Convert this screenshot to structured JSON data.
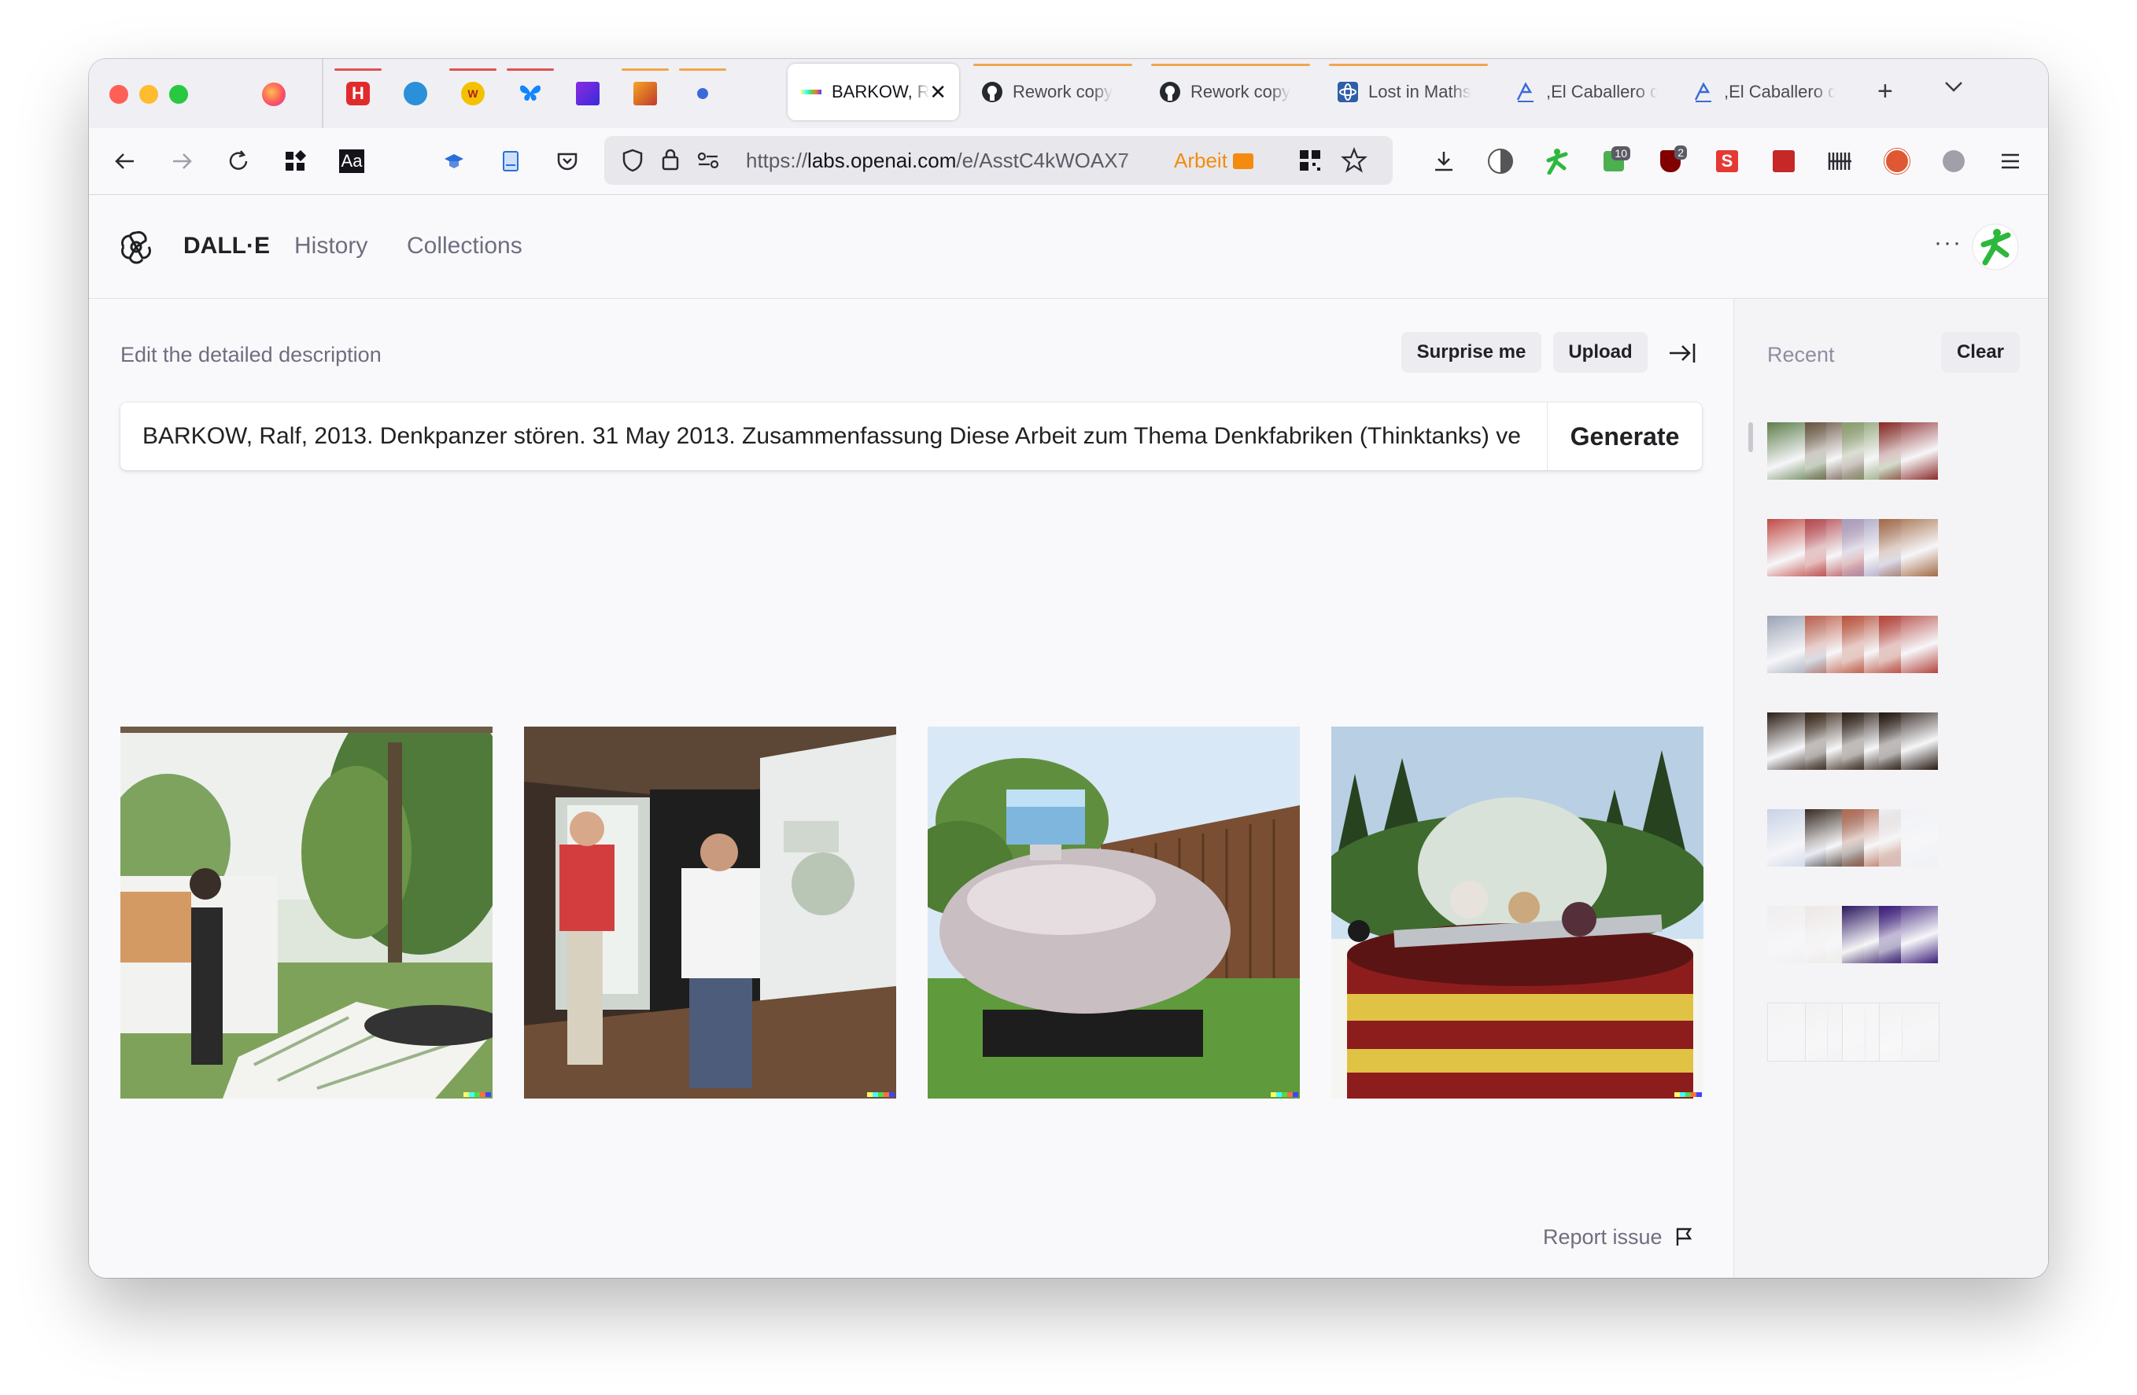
{
  "browser": {
    "pinned_tabs": [
      {
        "icon": "firefox-icon",
        "color": "#ff7139"
      },
      {
        "icon": "h-logo-icon",
        "color": "#e02b2b",
        "letter": "H"
      },
      {
        "icon": "globe-icon",
        "color": "#2a90d9"
      },
      {
        "icon": "wiki-icon",
        "color": "#c6a700"
      },
      {
        "icon": "butterfly-icon",
        "color": "#1185fe"
      },
      {
        "icon": "purple-square-icon",
        "color": "#6a2bd9"
      },
      {
        "icon": "gradient-square-icon",
        "color": "#e06a10"
      },
      {
        "icon": "dot-icon",
        "color": "#3a6ad9"
      }
    ],
    "tabs": [
      {
        "label": "BARKOW, R",
        "active": true
      },
      {
        "label": "Rework copy",
        "icon": "github-icon"
      },
      {
        "label": "Rework copy",
        "icon": "github-icon"
      },
      {
        "label": "Lost in Maths",
        "icon": "atom-icon"
      },
      {
        "label": ",El Caballero d",
        "icon": "tab-brand-icon"
      },
      {
        "label": ",El Caballero d",
        "icon": "tab-brand-icon"
      }
    ],
    "url_prefix": "https://",
    "url_host": "labs.openai.com",
    "url_path": "/e/AsstC4kWOAX7",
    "container_label": "Arbeit",
    "badges": {
      "ext1": "10",
      "ext2": "2"
    }
  },
  "app": {
    "brand": "DALL·E",
    "nav": {
      "history": "History",
      "collections": "Collections"
    },
    "more_label": "···"
  },
  "editor": {
    "label": "Edit the detailed description",
    "surprise_label": "Surprise me",
    "upload_label": "Upload",
    "prompt_value": "BARKOW, Ralf, 2013. Denkpanzer stören. 31 May 2013. Zusammenfassung Diese Arbeit zum Thema Denkfabriken (Thinktanks) ve",
    "generate_label": "Generate",
    "report_label": "Report issue"
  },
  "sidebar": {
    "title": "Recent",
    "clear_label": "Clear"
  },
  "results": [
    {
      "name": "result-image-park-map"
    },
    {
      "name": "result-image-exhibition"
    },
    {
      "name": "result-image-tank"
    },
    {
      "name": "result-image-drum"
    }
  ]
}
